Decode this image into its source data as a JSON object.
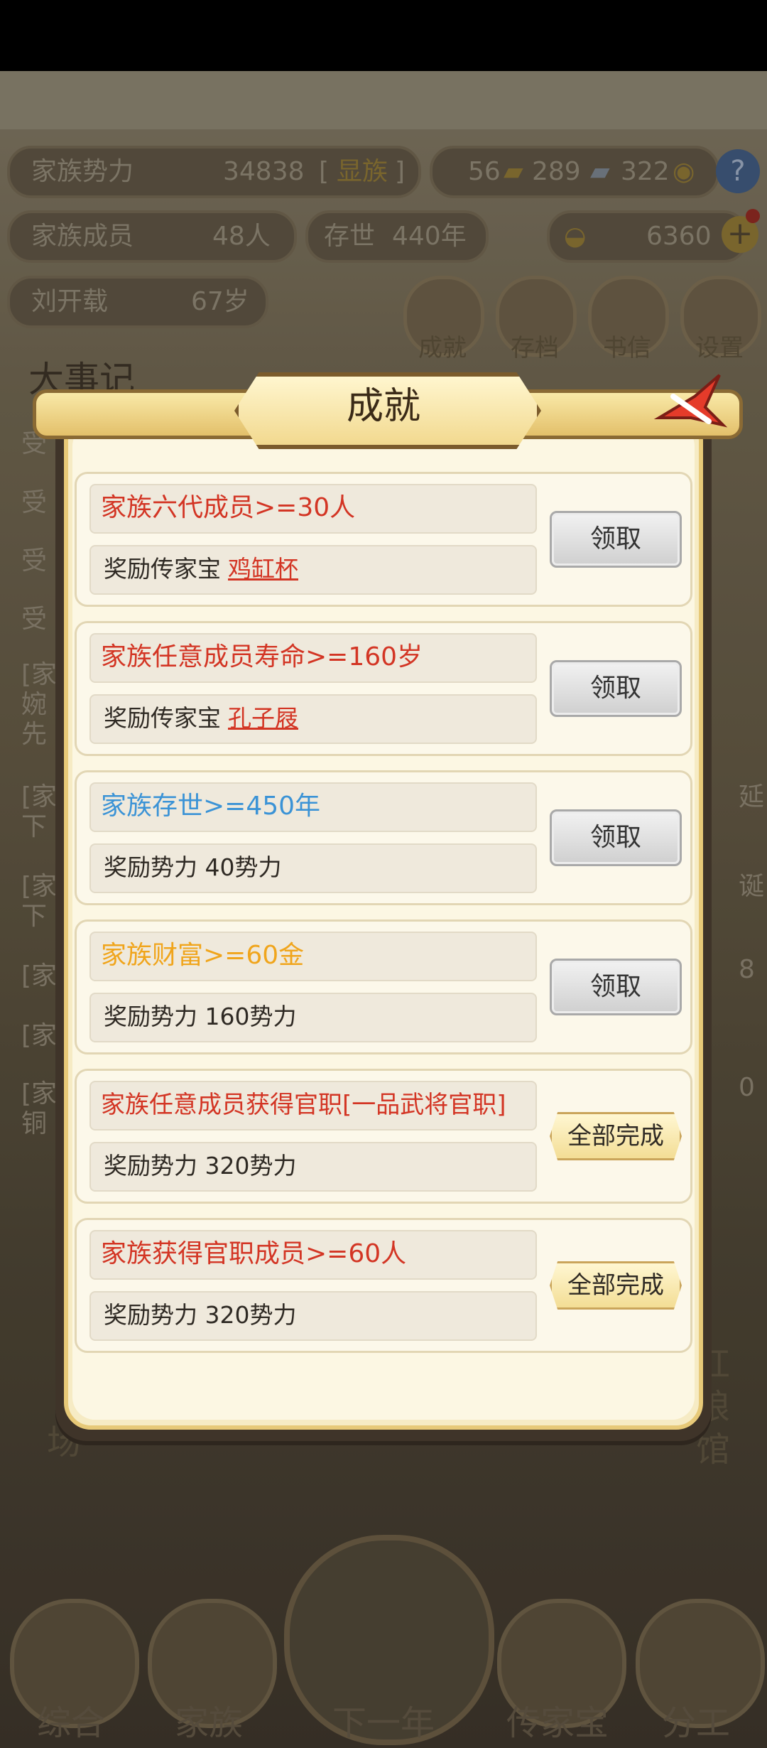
{
  "background": {
    "stats": {
      "power_label": "家族势力",
      "power_value": "34838",
      "power_rank_open": "[",
      "power_rank": "显族",
      "power_rank_close": "]",
      "gold": "56",
      "silver": "289",
      "coins": "322",
      "members_label": "家族成员",
      "members_value": "48人",
      "exist_label": "存世",
      "exist_value": "440年",
      "ingot": "6360",
      "leader_name": "刘开载",
      "leader_age": "67岁"
    },
    "top_icons": [
      "成就",
      "存档",
      "书信",
      "设置"
    ],
    "section_title": "大事记",
    "event_fragments": [
      "受",
      "受",
      "受",
      "受",
      "[家",
      "婉",
      "先",
      "[家",
      "下",
      "[家",
      "下",
      "[家",
      "[家",
      "[家",
      "铜"
    ],
    "right_fragments": [
      "延",
      "诞",
      "8",
      "0"
    ],
    "building_fragments": [
      "场",
      "红",
      "娘",
      "馆"
    ],
    "bottom_nav": [
      "综合",
      "家族",
      "下一年",
      "传家宝",
      "分工"
    ]
  },
  "modal": {
    "title": "成就",
    "achievements": [
      {
        "requirement": "家族六代成员>=30人",
        "req_color": "#d33524",
        "reward_prefix": "奖励传家宝",
        "reward_item": "鸡缸杯",
        "reward_text": "",
        "action": "领取",
        "done": false
      },
      {
        "requirement": "家族任意成员寿命>=160岁",
        "req_color": "#d33524",
        "reward_prefix": "奖励传家宝",
        "reward_item": "孔子屐",
        "reward_text": "",
        "action": "领取",
        "done": false
      },
      {
        "requirement": "家族存世>=450年",
        "req_color": "#3b93d6",
        "reward_prefix": "",
        "reward_item": "",
        "reward_text": "奖励势力 40势力",
        "action": "领取",
        "done": false
      },
      {
        "requirement": "家族财富>=60金",
        "req_color": "#f0a51c",
        "reward_prefix": "",
        "reward_item": "",
        "reward_text": "奖励势力 160势力",
        "action": "领取",
        "done": false
      },
      {
        "requirement": "家族任意成员获得官职[一品武将官职]",
        "req_color": "#d33524",
        "reward_prefix": "",
        "reward_item": "",
        "reward_text": "奖励势力 320势力",
        "action": "全部完成",
        "done": true
      },
      {
        "requirement": "家族获得官职成员>=60人",
        "req_color": "#d33524",
        "reward_prefix": "",
        "reward_item": "",
        "reward_text": "奖励势力 320势力",
        "action": "全部完成",
        "done": true
      }
    ]
  },
  "colors": {
    "modal_bg": "#fcf7e3",
    "red": "#d33524",
    "blue": "#3b93d6",
    "orange": "#f0a51c"
  }
}
